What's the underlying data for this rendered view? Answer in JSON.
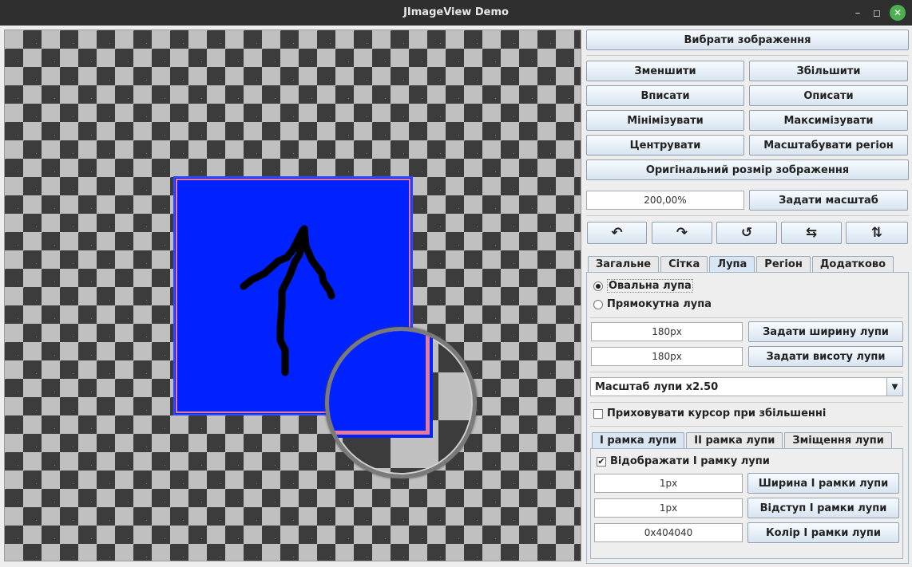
{
  "window": {
    "title": "JImageView Demo",
    "min_glyph": "–",
    "max_glyph": "◻",
    "close_glyph": "✕"
  },
  "top": {
    "choose_image": "Вибрати зображення"
  },
  "zoom": {
    "zoom_out": "Зменшити",
    "zoom_in": "Збільшити",
    "fit": "Вписати",
    "fill": "Описати",
    "minimize": "Мінімізувати",
    "maximize": "Максимізувати",
    "center": "Центрувати",
    "scale_region": "Масштабувати регіон",
    "original_size": "Оригінальний розмір зображення",
    "scale_value": "200,00%",
    "set_scale": "Задати масштаб"
  },
  "transform": {
    "icons": [
      "rotate-left-icon",
      "rotate-right-icon",
      "rotate-180-icon",
      "flip-horizontal-icon",
      "flip-vertical-icon"
    ],
    "glyphs": [
      "↶",
      "↷",
      "↺",
      "⇆",
      "⇅"
    ]
  },
  "tabs": [
    "Загальне",
    "Сітка",
    "Лупа",
    "Регіон",
    "Додатково"
  ],
  "active_tab": "Лупа",
  "magnifier": {
    "oval": "Овальна лупа",
    "rect": "Прямокутна лупа",
    "selected_shape": "Овальна лупа",
    "width_value": "180px",
    "set_width": "Задати ширину лупи",
    "height_value": "180px",
    "set_height": "Задати висоту лупи",
    "scale_selected": "Масштаб лупи x2.50",
    "hide_cursor": "Приховувати курсор при збільшенні",
    "hide_cursor_checked": false
  },
  "subtabs": [
    "I рамка лупи",
    "II рамка лупи",
    "Зміщення лупи"
  ],
  "frame1": {
    "show_label": "Відображати I рамку лупи",
    "show_checked": true,
    "width_value": "1px",
    "width_btn": "Ширина I рамки лупи",
    "padding_value": "1px",
    "padding_btn": "Відступ I рамки лупи",
    "color_value": "0x404040",
    "color_btn": "Колір I рамки лупи"
  },
  "colors": {
    "image_fill": "#0022ff",
    "frame_pink": "#e77b9c",
    "checker_dark": "#3c3c3c",
    "checker_light": "#c0c0c0"
  }
}
